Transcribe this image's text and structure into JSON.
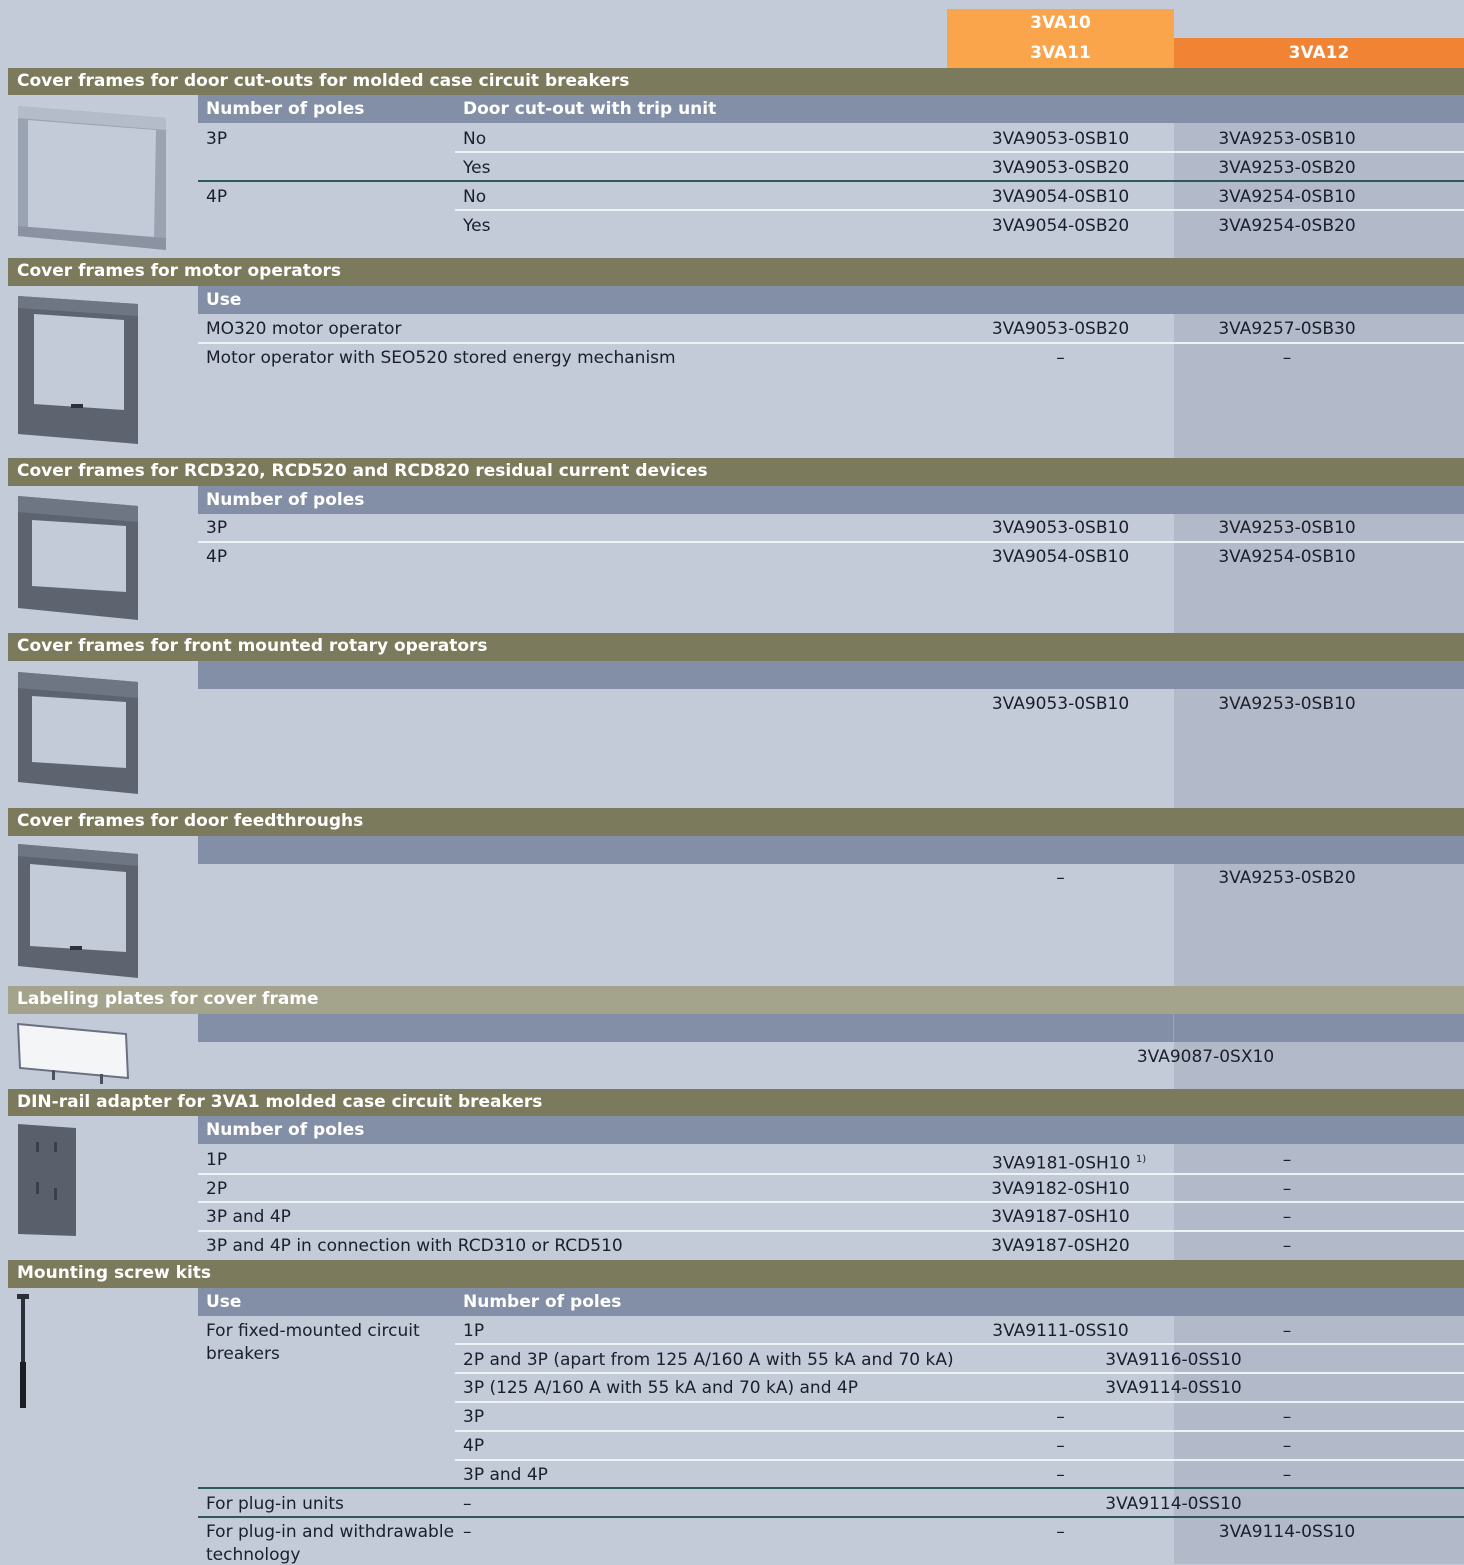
{
  "header": {
    "col1_line1": "3VA10",
    "col1_line2": "3VA11",
    "col2": "3VA12"
  },
  "s1": {
    "title": "Cover frames for door cut-outs for molded case circuit breakers",
    "h1": "Number of poles",
    "h2": "Door cut-out with trip unit",
    "rows": [
      {
        "poles": "3P",
        "trip": "No",
        "a": "3VA9053-0SB10",
        "b": "3VA9253-0SB10"
      },
      {
        "poles": "",
        "trip": "Yes",
        "a": "3VA9053-0SB20",
        "b": "3VA9253-0SB20"
      },
      {
        "poles": "4P",
        "trip": "No",
        "a": "3VA9054-0SB10",
        "b": "3VA9254-0SB10"
      },
      {
        "poles": "",
        "trip": "Yes",
        "a": "3VA9054-0SB20",
        "b": "3VA9254-0SB20"
      }
    ]
  },
  "s2": {
    "title": "Cover frames for motor operators",
    "h1": "Use",
    "rows": [
      {
        "use": "MO320 motor operator",
        "a": "3VA9053-0SB20",
        "b": "3VA9257-0SB30"
      },
      {
        "use": "Motor operator with SEO520 stored energy mechanism",
        "a": "–",
        "b": "–"
      }
    ]
  },
  "s3": {
    "title": "Cover frames for RCD320, RCD520 and RCD820 residual current devices",
    "h1": "Number of poles",
    "rows": [
      {
        "poles": "3P",
        "a": "3VA9053-0SB10",
        "b": "3VA9253-0SB10"
      },
      {
        "poles": "4P",
        "a": "3VA9054-0SB10",
        "b": "3VA9254-0SB10"
      }
    ]
  },
  "s4": {
    "title": "Cover frames for front mounted rotary operators",
    "a": "3VA9053-0SB10",
    "b": "3VA9253-0SB10"
  },
  "s5": {
    "title": "Cover frames for door feedthroughs",
    "a": "–",
    "b": "3VA9253-0SB20"
  },
  "s6": {
    "title": "Labeling plates for cover frame",
    "ab": "3VA9087-0SX10"
  },
  "s7": {
    "title": "DIN-rail adapter for 3VA1 molded case circuit breakers",
    "h1": "Number of poles",
    "rows": [
      {
        "poles": "1P",
        "a": "3VA9181-0SH10",
        "note": "1)",
        "b": "–"
      },
      {
        "poles": "2P",
        "a": "3VA9182-0SH10",
        "b": "–"
      },
      {
        "poles": "3P and 4P",
        "a": "3VA9187-0SH10",
        "b": "–"
      },
      {
        "poles": "3P and 4P in connection with RCD310 or RCD510",
        "a": "3VA9187-0SH20",
        "b": "–"
      }
    ]
  },
  "s8": {
    "title": "Mounting screw kits",
    "h1": "Use",
    "h2": "Number of poles",
    "use1_line1": "For fixed-mounted circuit",
    "use1_line2": "breakers",
    "rows": [
      {
        "poles": "1P",
        "a": "3VA9111-0SS10",
        "b": "–"
      },
      {
        "poles": "2P and 3P (apart from 125 A/160 A with 55 kA and 70 kA)",
        "ab": "3VA9116-0SS10"
      },
      {
        "poles": "3P (125 A/160 A with 55 kA and 70 kA) and 4P",
        "ab": "3VA9114-0SS10"
      },
      {
        "poles": "3P",
        "a": "–",
        "b": "–"
      },
      {
        "poles": "4P",
        "a": "–",
        "b": "–"
      },
      {
        "poles": "3P and 4P",
        "a": "–",
        "b": "–"
      }
    ],
    "plug": {
      "use": "For plug-in units",
      "poles": "–",
      "ab": "3VA9114-0SS10"
    },
    "plugw": {
      "use_line1": "For plug-in and withdrawable",
      "use_line2": "technology",
      "poles": "–",
      "a": "–",
      "b": "3VA9114-0SS10"
    }
  }
}
